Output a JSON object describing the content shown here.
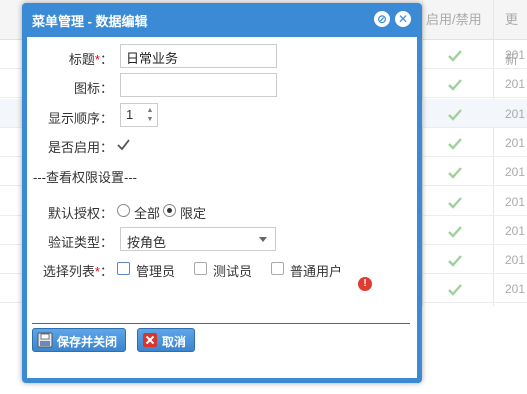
{
  "background": {
    "columns": [
      "启用/禁用",
      "更新"
    ],
    "row_year": "201",
    "rows": 9
  },
  "dialog": {
    "title": "菜单管理 - 数据编辑",
    "fields": {
      "title_label": "标题",
      "title_value": "日常业务",
      "icon_label": "图标：",
      "icon_value": "",
      "order_label": "显示顺序：",
      "order_value": "1",
      "enabled_label": "是否启用：",
      "enabled": true
    },
    "permissions": {
      "section_title": "---查看权限设置---",
      "default_label": "默认授权：",
      "options": [
        "全部",
        "限定"
      ],
      "selected": "限定",
      "verify_label": "验证类型：",
      "verify_value": "按角色",
      "list_label": "选择列表",
      "roles": [
        "管理员",
        "测试员",
        "普通用户"
      ]
    },
    "buttons": {
      "save": "保存并关闭",
      "cancel": "取消"
    }
  },
  "colors": {
    "dialog_blue": "#3a8ad6",
    "required": "#e2001a",
    "error": "#e03c31"
  }
}
